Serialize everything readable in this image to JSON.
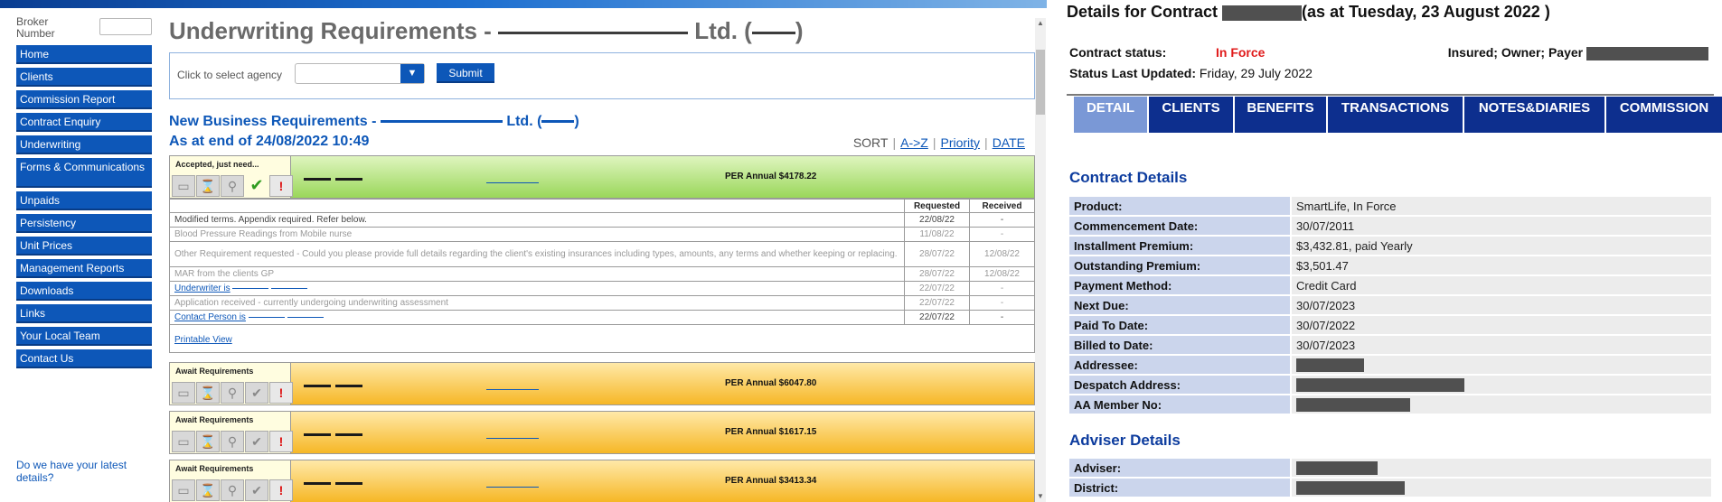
{
  "left": {
    "broker_label": "Broker Number",
    "nav": [
      "Home",
      "Clients",
      "Commission Report",
      "Contract Enquiry",
      "Underwriting",
      "Forms & Communications",
      "Unpaids",
      "Persistency",
      "Unit Prices",
      "Management Reports",
      "Downloads",
      "Links",
      "Your Local Team",
      "Contact Us"
    ],
    "latest_details": "Do we have your latest details?",
    "title_prefix": "Underwriting Requirements -",
    "title_suffix": "Ltd. (",
    "title_close": ")",
    "agency_label": "Click to select agency",
    "submit_label": "Submit",
    "nbr_prefix": "New Business Requirements -",
    "nbr_suffix": "Ltd. (",
    "nbr_close": ")",
    "as_at": "As at end of 24/08/2022 10:49",
    "sort_label": "SORT",
    "sort_az": "A->Z",
    "sort_priority": "Priority",
    "sort_date": "DATE",
    "table_headers": [
      "Requested",
      "Received"
    ],
    "cards": [
      {
        "status": "Accepted, just need...",
        "amount": "PER Annual $4178.22"
      },
      {
        "status": "Await Requirements",
        "amount": "PER Annual $6047.80"
      },
      {
        "status": "Await Requirements",
        "amount": "PER Annual $1617.15"
      },
      {
        "status": "Await Requirements",
        "amount": "PER Annual $3413.34"
      }
    ],
    "rows": [
      {
        "text": "Modified terms. Appendix required. Refer below.",
        "req": "22/08/22",
        "rec": "-"
      },
      {
        "text": "Blood Pressure Readings from Mobile nurse",
        "req": "11/08/22",
        "rec": "-"
      },
      {
        "text": "Other Requirement requested - Could you please provide full details regarding the client's existing insurances including types, amounts, any terms and whether keeping or replacing.",
        "req": "28/07/22",
        "rec": "12/08/22"
      },
      {
        "text": "MAR from the clients GP",
        "req": "28/07/22",
        "rec": "12/08/22"
      },
      {
        "text": "Underwriter is",
        "req": "22/07/22",
        "rec": "-"
      },
      {
        "text": "Application received - currently undergoing underwriting assessment",
        "req": "22/07/22",
        "rec": "-"
      },
      {
        "text": "Contact Person is",
        "req": "22/07/22",
        "rec": "-"
      }
    ],
    "printable_view": "Printable View"
  },
  "right": {
    "title_prefix": "Details for Contract",
    "title_suffix": "(as at Tuesday, 23 August 2022 )",
    "contract_status_label": "Contract status:",
    "contract_status_value": "In Force",
    "parties_label": "Insured; Owner; Payer",
    "status_updated_label": "Status Last Updated:",
    "status_updated_value": "Friday, 29 July 2022",
    "tabs": [
      "DETAIL",
      "CLIENTS",
      "BENEFITS",
      "TRANSACTIONS",
      "NOTES&DIARIES",
      "COMMISSION"
    ],
    "contract_details_heading": "Contract Details",
    "contract_details": [
      {
        "label": "Product:",
        "value": "SmartLife, In Force"
      },
      {
        "label": "Commencement Date:",
        "value": "30/07/2011"
      },
      {
        "label": "Installment Premium:",
        "value": "$3,432.81, paid Yearly"
      },
      {
        "label": "Outstanding Premium:",
        "value": "$3,501.47"
      },
      {
        "label": "Payment Method:",
        "value": "Credit Card"
      },
      {
        "label": "Next Due:",
        "value": "30/07/2023"
      },
      {
        "label": "Paid To Date:",
        "value": "30/07/2022"
      },
      {
        "label": "Billed to Date:",
        "value": "30/07/2023"
      },
      {
        "label": "Addressee:",
        "value": ""
      },
      {
        "label": "Despatch Address:",
        "value": ""
      },
      {
        "label": "AA Member No:",
        "value": ""
      }
    ],
    "adviser_details_heading": "Adviser Details",
    "adviser_details": [
      {
        "label": "Adviser:",
        "value": ""
      },
      {
        "label": "District:",
        "value": ""
      }
    ]
  }
}
